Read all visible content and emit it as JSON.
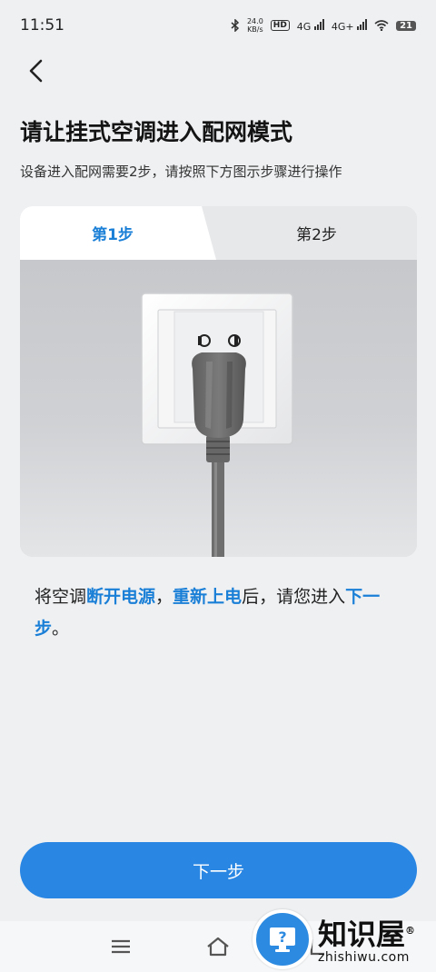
{
  "status_bar": {
    "time": "11:51",
    "net_speed_value": "24.0",
    "net_speed_unit": "KB/s",
    "hd_badge": "HD",
    "network_1": "4G",
    "network_2": "4G+",
    "battery": "21"
  },
  "header": {
    "title": "请让挂式空调进入配网模式",
    "subtitle": "设备进入配网需要2步，请按照下方图示步骤进行操作"
  },
  "steps": {
    "tabs": [
      {
        "label": "第1步",
        "active": true
      },
      {
        "label": "第2步",
        "active": false
      }
    ]
  },
  "instruction": {
    "part1": "将空调",
    "highlight1": "断开电源",
    "part2": "，",
    "highlight2": "重新上电",
    "part3": "后，请您进入",
    "highlight3": "下一步",
    "part4": "。"
  },
  "footer": {
    "next_label": "下一步"
  },
  "watermark": {
    "name_cn": "知识屋",
    "reg_mark": "®",
    "name_en": "zhishiwu.com"
  },
  "colors": {
    "accent": "#1a7fd6",
    "button": "#2a86e3",
    "background": "#eef0f2"
  }
}
